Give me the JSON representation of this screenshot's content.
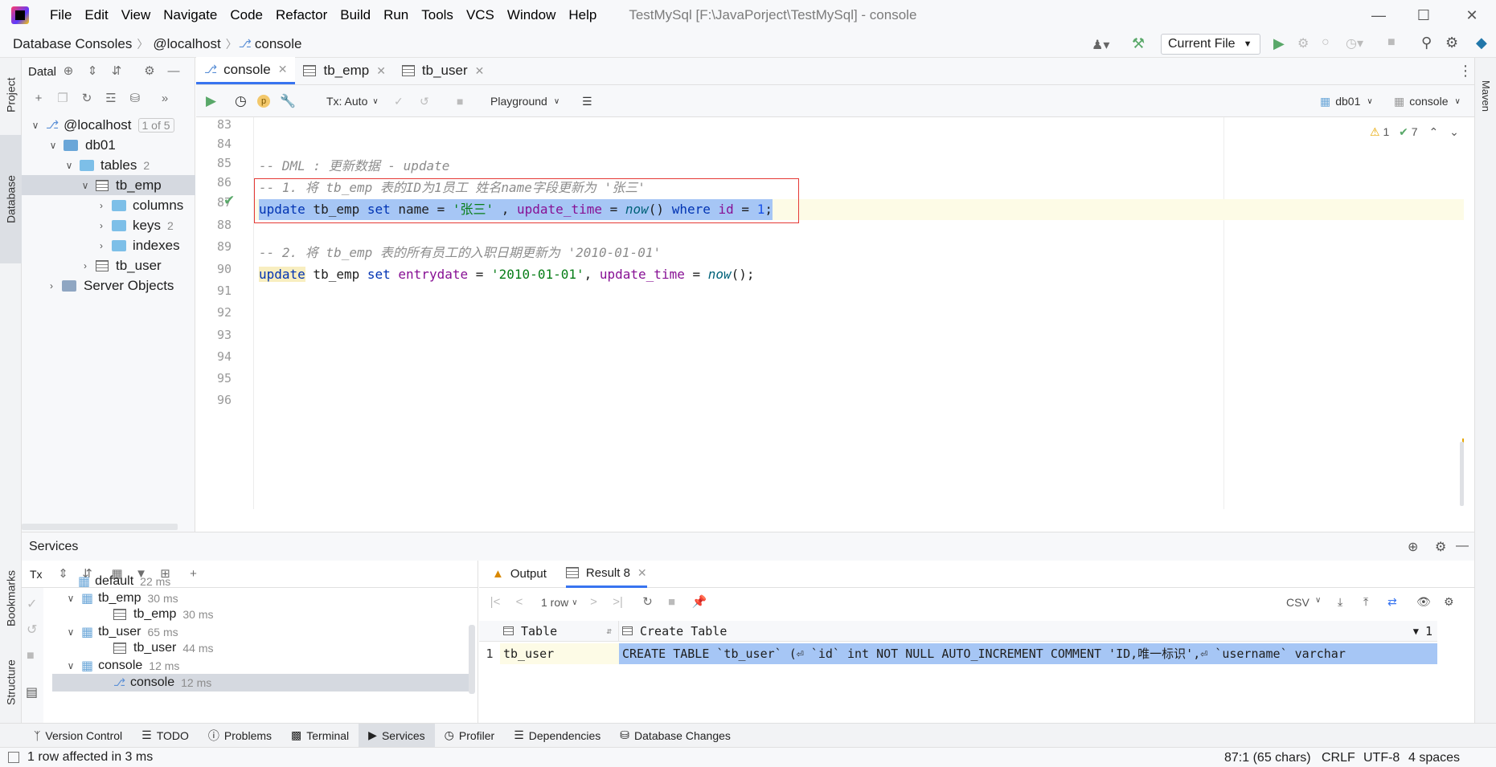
{
  "menu": [
    "File",
    "Edit",
    "View",
    "Navigate",
    "Code",
    "Refactor",
    "Build",
    "Run",
    "Tools",
    "VCS",
    "Window",
    "Help"
  ],
  "window_title": "TestMySql [F:\\JavaPorject\\TestMySql] - console",
  "breadcrumbs": [
    "Database Consoles",
    "@localhost",
    "console"
  ],
  "run_config": "Current File",
  "left_strip": {
    "project": "Project",
    "database": "Database",
    "bookmarks": "Bookmarks",
    "structure": "Structure"
  },
  "right_strip": {
    "maven": "Maven"
  },
  "db_panel": {
    "title": "Datal",
    "tree": [
      {
        "label": "@localhost",
        "extra": "1 of 5"
      },
      {
        "label": "db01",
        "extra": ""
      },
      {
        "label": "tables",
        "extra": "2"
      },
      {
        "label": "tb_emp",
        "extra": ""
      },
      {
        "label": "columns",
        "extra": ""
      },
      {
        "label": "keys",
        "extra": "2"
      },
      {
        "label": "indexes",
        "extra": ""
      },
      {
        "label": "tb_user",
        "extra": ""
      },
      {
        "label": "Server Objects",
        "extra": ""
      }
    ]
  },
  "editor_tabs": [
    "console",
    "tb_emp",
    "tb_user"
  ],
  "editor_toolbar": {
    "tx": "Tx: Auto",
    "playground": "Playground",
    "schema": "db01",
    "session": "console"
  },
  "inspections": {
    "warnings": "1",
    "ok": "7"
  },
  "code": {
    "line_numbers": [
      "83",
      "84",
      "85",
      "86",
      "87",
      "88",
      "89",
      "90",
      "91",
      "92",
      "93",
      "94",
      "95",
      "96"
    ],
    "lines": {
      "l85": "-- DML : 更新数据 - update",
      "l86": "-- 1. 将 tb_emp 表的ID为1员工 姓名name字段更新为 '张三'",
      "l87_a": "update",
      "l87_b": " tb_emp ",
      "l87_c": "set",
      "l87_d": " name = ",
      "l87_e": "'张三'",
      "l87_f": " , ",
      "l87_g": "update_time",
      "l87_h": " = ",
      "l87_i": "now",
      "l87_j": "() ",
      "l87_k": "where",
      "l87_l": " ",
      "l87_m": "id",
      "l87_n": " = ",
      "l87_o": "1",
      "l87_p": ";",
      "l89": "-- 2. 将 tb_emp 表的所有员工的入职日期更新为 '2010-01-01'",
      "l90_a": "update",
      "l90_b": " tb_emp ",
      "l90_c": "set",
      "l90_d": " ",
      "l90_e": "entrydate",
      "l90_f": " = ",
      "l90_g": "'2010-01-01'",
      "l90_h": ", ",
      "l90_i": "update_time",
      "l90_j": " = ",
      "l90_k": "now",
      "l90_l": "();"
    }
  },
  "services": {
    "title": "Services",
    "tx_label": "Tx",
    "tree": [
      {
        "label": "default",
        "time": "22 ms"
      },
      {
        "label": "tb_emp",
        "time": "30 ms"
      },
      {
        "label": "tb_emp",
        "time": "30 ms"
      },
      {
        "label": "tb_user",
        "time": "65 ms"
      },
      {
        "label": "tb_user",
        "time": "44 ms"
      },
      {
        "label": "console",
        "time": "12 ms"
      },
      {
        "label": "console",
        "time": "12 ms"
      }
    ],
    "result_tabs": [
      "Output",
      "Result 8"
    ],
    "rows_label": "1 row",
    "export_format": "CSV",
    "columns": [
      "Table",
      "Create Table"
    ],
    "col_count": "1",
    "rows": [
      [
        "1",
        "tb_user",
        "CREATE TABLE `tb_user` (⏎  `id` int NOT NULL AUTO_INCREMENT COMMENT 'ID,唯一标识',⏎  `username` varchar"
      ]
    ]
  },
  "bottom_tabs": [
    "Version Control",
    "TODO",
    "Problems",
    "Terminal",
    "Services",
    "Profiler",
    "Dependencies",
    "Database Changes"
  ],
  "status": {
    "message": "1 row affected in 3 ms",
    "position": "87:1 (65 chars)",
    "line_sep": "CRLF",
    "encoding": "UTF-8",
    "indent": "4 spaces"
  }
}
